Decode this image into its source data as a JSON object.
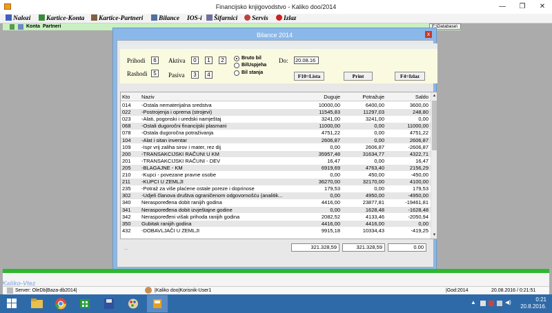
{
  "window": {
    "title": "Financijsko knjigovodstvo - Kaliko doo/2014",
    "minimize": "—",
    "maximize": "❐",
    "close": "✕"
  },
  "menu": [
    {
      "label": "Nalozi",
      "icon": "document-icon",
      "color": "#4060c0"
    },
    {
      "label": "Kartice-Konta",
      "icon": "table-icon",
      "color": "#3a8a3a"
    },
    {
      "label": "Kartice-Partneri",
      "icon": "people-icon",
      "color": "#806040"
    },
    {
      "label": "Bilance",
      "icon": "report-icon",
      "color": "#5070a0"
    },
    {
      "label": "IOS-i",
      "icon": "none",
      "color": "#000000"
    },
    {
      "label": "Šifarnici",
      "icon": "wrench-icon",
      "color": "#7070a0"
    },
    {
      "label": "Servis",
      "icon": "gear-icon",
      "color": "#c04040"
    },
    {
      "label": "Izlaz",
      "icon": "exit-icon",
      "color": "#d02020"
    }
  ],
  "toolbar": {
    "konta": "Konta",
    "partneri": "Partneri",
    "database": "F:\\Database\\"
  },
  "dialog": {
    "title": "Bilance 2014",
    "close": "x",
    "prihodi_label": "Prihodi",
    "prihodi_value": "6",
    "rashodi_label": "Rashodi",
    "rashodi_value": "5",
    "aktiva_label": "Aktiva",
    "aktiva_values": [
      "0",
      "1",
      "2"
    ],
    "pasiva_label": "Pasiva",
    "pasiva_values": [
      "3",
      "4"
    ],
    "radio_options": [
      "Bruto bil",
      "BilUspjeha",
      "Bil stanja"
    ],
    "radio_selected": 0,
    "do_label": "Do:",
    "do_value": "20.08.16",
    "buttons": {
      "lista": "F10=Lista",
      "print": "Print",
      "izlaz": "F4=Izlaz"
    },
    "columns": {
      "kto": "Kto",
      "naziv": "Naziv",
      "duguje": "Duguje",
      "potrazuje": "Potražuje",
      "saldo": "Saldo"
    },
    "rows": [
      {
        "kto": "014",
        "naziv": "-Ostala nematerijalna  sredstva",
        "duguje": "10000,00",
        "potrazuje": "6400,00",
        "saldo": "3600,00"
      },
      {
        "kto": "022",
        "naziv": "-Postrojenja i oprema (strojevi)",
        "duguje": "11545,83",
        "potrazuje": "11297,03",
        "saldo": "248,80"
      },
      {
        "kto": "023",
        "naziv": "-Alati, pogonski i uredski namještaj",
        "duguje": "3241,00",
        "potrazuje": "3241,00",
        "saldo": "0,00"
      },
      {
        "kto": "068",
        "naziv": "-Ostali dugoročni financijski plasmani",
        "duguje": "11000,00",
        "potrazuje": "0,00",
        "saldo": "11000,00"
      },
      {
        "kto": "078",
        "naziv": "-Ostala dugoročna potraživanja",
        "duguje": "4751,22",
        "potrazuje": "0,00",
        "saldo": "4751,22"
      },
      {
        "kto": "104",
        "naziv": "-Alat i sitan inventar",
        "duguje": "2606,87",
        "potrazuje": "0,00",
        "saldo": "2606,87"
      },
      {
        "kto": "109",
        "naziv": "-Ispr vrij zaliha sirov i mater, rez dij",
        "duguje": "0,00",
        "potrazuje": "2606,87",
        "saldo": "-2606,87"
      },
      {
        "kto": "200",
        "naziv": "-TRANSAKCIJSKI RAČUNI U KM",
        "duguje": "35957,48",
        "potrazuje": "31634,77",
        "saldo": "4322,71"
      },
      {
        "kto": "201",
        "naziv": "-TRANSAKCIJSKI RAČUNI - DEV",
        "duguje": "16,47",
        "potrazuje": "0,00",
        "saldo": "16,47"
      },
      {
        "kto": "205",
        "naziv": "-BLAGAJNE - KM",
        "duguje": "6919,69",
        "potrazuje": "4763,40",
        "saldo": "2156,29"
      },
      {
        "kto": "210",
        "naziv": "-Kupci - povezane pravne osobe",
        "duguje": "0,00",
        "potrazuje": "450,00",
        "saldo": "-450,00"
      },
      {
        "kto": "211",
        "naziv": "-KUPCI U ZEMLJI",
        "duguje": "36270,00",
        "potrazuje": "32170,00",
        "saldo": "4100,00"
      },
      {
        "kto": "235",
        "naziv": "-Potraž za više plaćene ostale poreze i doprinose",
        "duguje": "179,53",
        "potrazuje": "0,00",
        "saldo": "179,53"
      },
      {
        "kto": "302",
        "naziv": "-Udjeli članova društva ograničenom odgovornošću (analitik...",
        "duguje": "0,00",
        "potrazuje": "4950,00",
        "saldo": "-4950,00"
      },
      {
        "kto": "340",
        "naziv": "Neraspoređena dobit ranijih godina",
        "duguje": "4416,00",
        "potrazuje": "23877,81",
        "saldo": "-19461,81"
      },
      {
        "kto": "341",
        "naziv": "Neraspoređena dobit izvještajne godine",
        "duguje": "0,00",
        "potrazuje": "1628,48",
        "saldo": "-1628,48"
      },
      {
        "kto": "342",
        "naziv": "Neraspoređeni višak prihoda ranijih godina",
        "duguje": "2082,52",
        "potrazuje": "4133,46",
        "saldo": "-2050,94"
      },
      {
        "kto": "350",
        "naziv": "Gubitak ranijih godina",
        "duguje": "4416,00",
        "potrazuje": "4416,00",
        "saldo": "0,00"
      },
      {
        "kto": "432",
        "naziv": "-DOBAVLJAČI U ZEMLJI",
        "duguje": "9915,18",
        "potrazuje": "10334,43",
        "saldo": "-419,25"
      }
    ],
    "footer_dots": "...",
    "totals": {
      "duguje": "321.328,59",
      "potrazuje": "321.328,59",
      "saldo": "0.00"
    }
  },
  "app_logo": "Kaliko-Vtez",
  "statusbar": {
    "server": "Server: OleDb|Baza-db2014|",
    "user": "|Kaliko doo|Korisnik-User1",
    "god": "|God:2014",
    "datetime": "20.08.2016 / 0:21:51"
  },
  "taskbar": {
    "time": "0:21",
    "date": "20.8.2016."
  }
}
